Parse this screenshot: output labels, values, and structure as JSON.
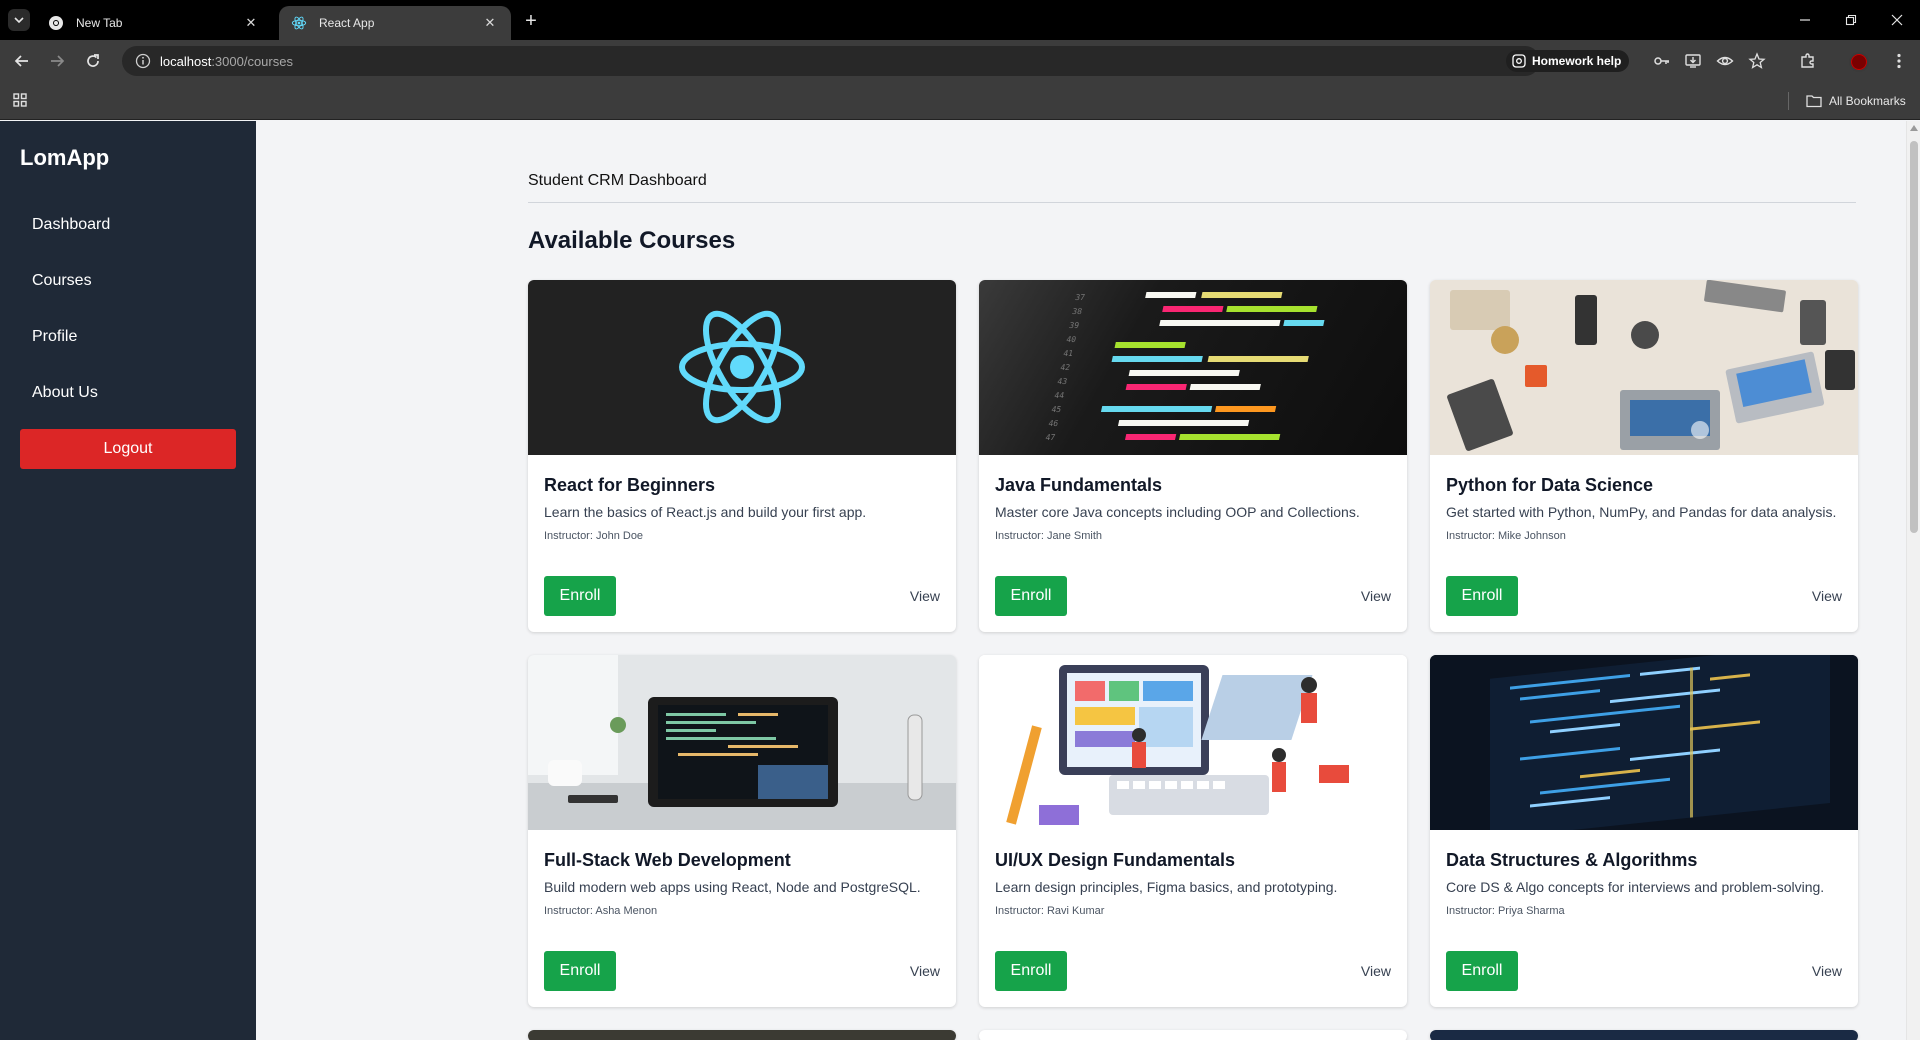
{
  "browser": {
    "tabs": [
      {
        "title": "New Tab",
        "favicon": "chrome-icon",
        "active": false
      },
      {
        "title": "React App",
        "favicon": "react-icon",
        "active": true
      }
    ],
    "url_host": "localhost",
    "url_path": ":3000/courses",
    "homework_chip": "Homework help",
    "bookmarks_label": "All Bookmarks"
  },
  "sidebar": {
    "brand": "LomApp",
    "items": [
      {
        "label": "Dashboard"
      },
      {
        "label": "Courses"
      },
      {
        "label": "Profile"
      },
      {
        "label": "About Us"
      }
    ],
    "logout_label": "Logout",
    "logout_color": "#dc2626",
    "bg_color": "#1f2937"
  },
  "main": {
    "breadcrumb": "Student CRM Dashboard",
    "heading": "Available Courses",
    "enroll_color": "#16a34a",
    "courses": [
      {
        "title": "React for Beginners",
        "description": "Learn the basics of React.js and build your first app.",
        "instructor": "Instructor: John Doe",
        "enroll": "Enroll",
        "view": "View",
        "image": "react-logo"
      },
      {
        "title": "Java Fundamentals",
        "description": "Master core Java concepts including OOP and Collections.",
        "instructor": "Instructor: Jane Smith",
        "enroll": "Enroll",
        "view": "View",
        "image": "code-screen"
      },
      {
        "title": "Python for Data Science",
        "description": "Get started with Python, NumPy, and Pandas for data analysis.",
        "instructor": "Instructor: Mike Johnson",
        "enroll": "Enroll",
        "view": "View",
        "image": "team-desk"
      },
      {
        "title": "Full-Stack Web Development",
        "description": "Build modern web apps using React, Node and PostgreSQL.",
        "instructor": "Instructor: Asha Menon",
        "enroll": "Enroll",
        "view": "View",
        "image": "laptop-desk"
      },
      {
        "title": "UI/UX Design Fundamentals",
        "description": "Learn design principles, Figma basics, and prototyping.",
        "instructor": "Instructor: Ravi Kumar",
        "enroll": "Enroll",
        "view": "View",
        "image": "design-illustration"
      },
      {
        "title": "Data Structures & Algorithms",
        "description": "Core DS & Algo concepts for interviews and problem-solving.",
        "instructor": "Instructor: Priya Sharma",
        "enroll": "Enroll",
        "view": "View",
        "image": "code-monitor"
      }
    ]
  }
}
